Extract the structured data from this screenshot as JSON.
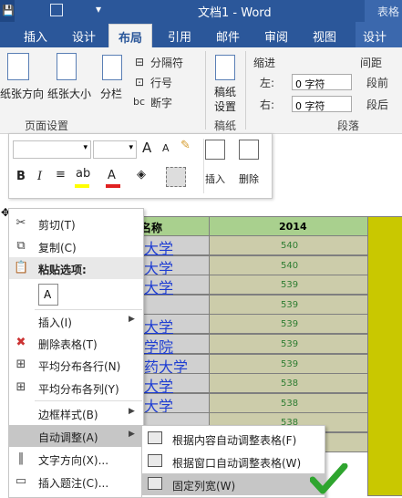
{
  "titlebar": {
    "title": "文档1 - Word",
    "right_label": "表格"
  },
  "tabs": [
    "插入",
    "设计",
    "布局",
    "引用",
    "邮件",
    "审阅",
    "视图",
    "设计"
  ],
  "ribbon": {
    "page_setup": {
      "paper_direction": "纸张方向",
      "paper_size": "纸张大小",
      "columns": "分栏",
      "separator": "分隔符",
      "line_number": "行号",
      "hyphenation": "断字",
      "group_label": "页面设置"
    },
    "draft": {
      "label1": "稿纸",
      "label2": "设置",
      "group_label": "稿纸"
    },
    "indent": {
      "title": "缩进",
      "left_label": "左:",
      "left_value": "0 字符",
      "right_label": "右:",
      "right_value": "0 字符"
    },
    "spacing": {
      "title": "间距",
      "before_label": "段前",
      "after_label": "段后"
    },
    "paragraph_group": "段落"
  },
  "mini_toolbar": {
    "bold": "B",
    "italic": "I",
    "font_color": "A",
    "insert_label": "插入",
    "delete_label": "删除",
    "grow_font": "A",
    "shrink_font": "A",
    "highlight_color": "#ffff00",
    "font_color_value": "#e02020"
  },
  "table": {
    "header_col": "名称",
    "header_year": "2014",
    "rows": [
      {
        "name": "大学",
        "value": "540"
      },
      {
        "name": "大学",
        "value": "540"
      },
      {
        "name": "大学",
        "value": "539"
      },
      {
        "name": "",
        "value": "539"
      },
      {
        "name": "大学",
        "value": "539"
      },
      {
        "name": "学院",
        "value": "539"
      },
      {
        "name": "药大学",
        "value": "539"
      },
      {
        "name": "大学",
        "value": "538"
      },
      {
        "name": "大学",
        "value": "538"
      },
      {
        "name": "",
        "value": "538"
      },
      {
        "name": "",
        "value": ""
      }
    ]
  },
  "context_menu": {
    "cut": "剪切(T)",
    "copy": "复制(C)",
    "paste_options": "粘贴选项:",
    "insert": "插入(I)",
    "delete_table": "删除表格(T)",
    "distribute_rows": "平均分布各行(N)",
    "distribute_cols": "平均分布各列(Y)",
    "border_style": "边框样式(B)",
    "autofit": "自动调整(A)",
    "text_direction": "文字方向(X)...",
    "insert_caption": "插入题注(C)..."
  },
  "submenu": {
    "autofit_content": "根据内容自动调整表格(F)",
    "autofit_window": "根据窗口自动调整表格(W)",
    "fixed_width": "固定列宽(W)"
  }
}
